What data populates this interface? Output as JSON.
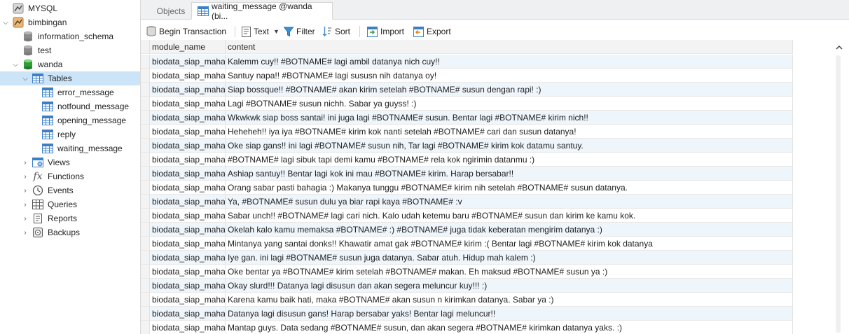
{
  "sidebar": {
    "items": [
      {
        "label": "MYSQL",
        "icon": "mysql-connection-icon"
      },
      {
        "label": "bimbingan",
        "icon": "connection-icon"
      },
      {
        "label": "information_schema",
        "icon": "database-icon"
      },
      {
        "label": "test",
        "icon": "database-icon"
      },
      {
        "label": "wanda",
        "icon": "database-open-icon"
      },
      {
        "label": "Tables",
        "icon": "tables-icon"
      },
      {
        "label": "error_message",
        "icon": "table-icon"
      },
      {
        "label": "notfound_message",
        "icon": "table-icon"
      },
      {
        "label": "opening_message",
        "icon": "table-icon"
      },
      {
        "label": "reply",
        "icon": "table-icon"
      },
      {
        "label": "waiting_message",
        "icon": "table-icon"
      },
      {
        "label": "Views",
        "icon": "views-icon"
      },
      {
        "label": "Functions",
        "icon": "function-icon"
      },
      {
        "label": "Events",
        "icon": "events-icon"
      },
      {
        "label": "Queries",
        "icon": "queries-icon"
      },
      {
        "label": "Reports",
        "icon": "reports-icon"
      },
      {
        "label": "Backups",
        "icon": "backups-icon"
      }
    ]
  },
  "tabs": {
    "objects_label": "Objects",
    "active_label": "waiting_message @wanda (bi..."
  },
  "toolbar": {
    "begin_transaction": "Begin Transaction",
    "text": "Text",
    "filter": "Filter",
    "sort": "Sort",
    "import": "Import",
    "export": "Export"
  },
  "grid": {
    "columns": [
      "module_name",
      "content"
    ],
    "rows": [
      [
        "biodata_siap_mahasiswa",
        "Kalemm cuy!! #BOTNAME# lagi ambil datanya nich cuy!!"
      ],
      [
        "biodata_siap_mahasiswa",
        "Santuy napa!! #BOTNAME# lagi sususn nih datanya oy!"
      ],
      [
        "biodata_siap_mahasiswa",
        "Siap bossque!! #BOTNAME# akan kirim setelah #BOTNAME# susun dengan rapi! :)"
      ],
      [
        "biodata_siap_mahasiswa",
        "Lagi #BOTNAME# susun nichh. Sabar ya guyss! :)"
      ],
      [
        "biodata_siap_mahasiswa",
        "Wkwkwk siap boss santai! ini juga lagi #BOTNAME# susun. Bentar lagi #BOTNAME# kirim nich!!"
      ],
      [
        "biodata_siap_mahasiswa",
        "Heheheh!! iya iya #BOTNAME# kirim kok nanti setelah #BOTNAME# cari dan susun datanya!"
      ],
      [
        "biodata_siap_mahasiswa",
        "Oke siap gans!! ini lagi #BOTNAME# susun nih, Tar lagi #BOTNAME# kirim kok datamu santuy."
      ],
      [
        "biodata_siap_mahasiswa",
        "#BOTNAME# lagi sibuk tapi demi kamu #BOTNAME# rela kok ngirimin datanmu :)"
      ],
      [
        "biodata_siap_mahasiswa",
        "Ashiap santuy!! Bentar lagi kok ini mau #BOTNAME# kirim. Harap bersabar!!"
      ],
      [
        "biodata_siap_mahasiswa",
        "Orang sabar pasti bahagia :) Makanya tunggu #BOTNAME# kirim nih setelah #BOTNAME# susun datanya."
      ],
      [
        "biodata_siap_mahasiswa",
        "Ya, #BOTNAME# susun dulu ya biar rapi kaya #BOTNAME# :v"
      ],
      [
        "biodata_siap_mahasiswa",
        "Sabar unch!! #BOTNAME# lagi cari nich. Kalo udah ketemu baru #BOTNAME# susun dan kirim ke kamu kok."
      ],
      [
        "biodata_siap_mahasiswa",
        "Okelah kalo kamu memaksa #BOTNAME# :) #BOTNAME# juga tidak keberatan mengirim datanya :)"
      ],
      [
        "biodata_siap_mahasiswa",
        "Mintanya yang santai donks!! Khawatir amat gak #BOTNAME# kirim :( Bentar lagi #BOTNAME# kirim kok datanya"
      ],
      [
        "biodata_siap_mahasiswa",
        "Iye gan. ini lagi #BOTNAME# susun juga datanya. Sabar atuh. Hidup mah kalem :)"
      ],
      [
        "biodata_siap_mahasiswa",
        "Oke bentar ya #BOTNAME# kirim setelah #BOTNAME# makan. Eh maksud #BOTNAME# susun ya :)"
      ],
      [
        "biodata_siap_mahasiswa",
        "Okay slurd!!! Datanya lagi disusun dan akan segera meluncur kuy!!! :)"
      ],
      [
        "biodata_siap_mahasiswa",
        "Karena kamu baik hati, maka #BOTNAME# akan susun n kirimkan datanya. Sabar ya :)"
      ],
      [
        "biodata_siap_mahasiswa",
        "Datanya lagi disusun gans! Harap bersabar yaks! Bentar lagi meluncur!!"
      ],
      [
        "biodata_siap_mahasiswa",
        "Mantap guys. Data sedang #BOTNAME# susun, dan akan segera #BOTNAME# kirimkan datanya yaks. :)"
      ]
    ]
  }
}
